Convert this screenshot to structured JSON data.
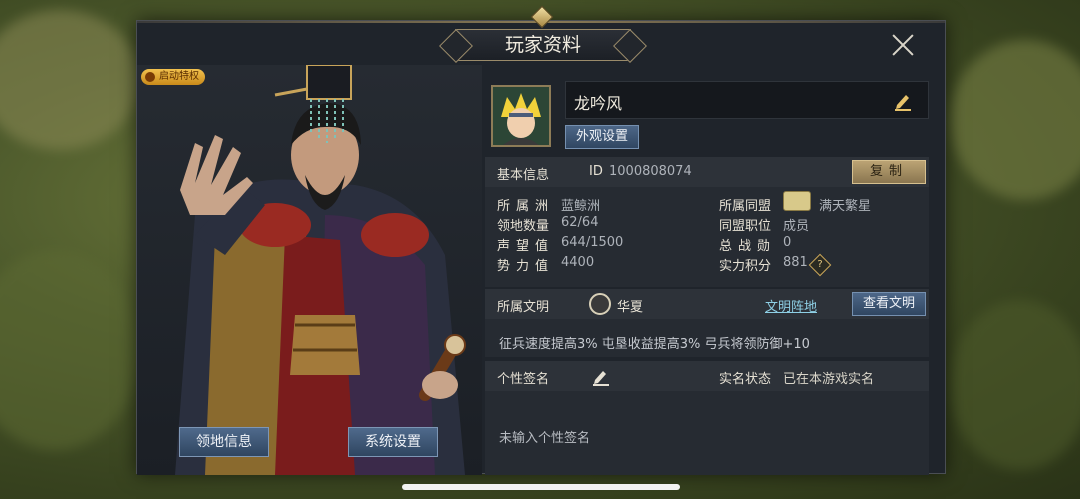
{
  "dialog": {
    "title": "玩家资料",
    "close_icon": "close-icon"
  },
  "hero": {
    "badge": "启动特权",
    "buttons": {
      "territory": "领地信息",
      "settings": "系统设置"
    }
  },
  "profile": {
    "name": "龙吟风",
    "appearance_button": "外观设置"
  },
  "basic": {
    "title": "基本信息",
    "id_label": "ID",
    "id_value": "1000808074",
    "copy_button": "复制",
    "continent_label": "所属洲",
    "continent_value": "蓝鲸洲",
    "territory_count_label": "领地数量",
    "territory_count_value": "62/64",
    "prestige_label": "声望值",
    "prestige_value": "644/1500",
    "power_label": "势力值",
    "power_value": "4400",
    "alliance_label": "所属同盟",
    "alliance_value": "满天繁星",
    "alliance_role_label": "同盟职位",
    "alliance_role_value": "成员",
    "battle_merit_label": "总战勋",
    "battle_merit_value": "0",
    "strength_label": "实力积分",
    "strength_value": "881",
    "help_glyph": "?"
  },
  "civilization": {
    "label": "所属文明",
    "value": "华夏",
    "link": "文明阵地",
    "view_button": "查看文明",
    "bonus": "征兵速度提高3%  屯垦收益提高3%  弓兵将领防御+10"
  },
  "signature": {
    "label": "个性签名",
    "realname_label": "实名状态",
    "realname_value": "已在本游戏实名",
    "placeholder": "未输入个性签名"
  }
}
